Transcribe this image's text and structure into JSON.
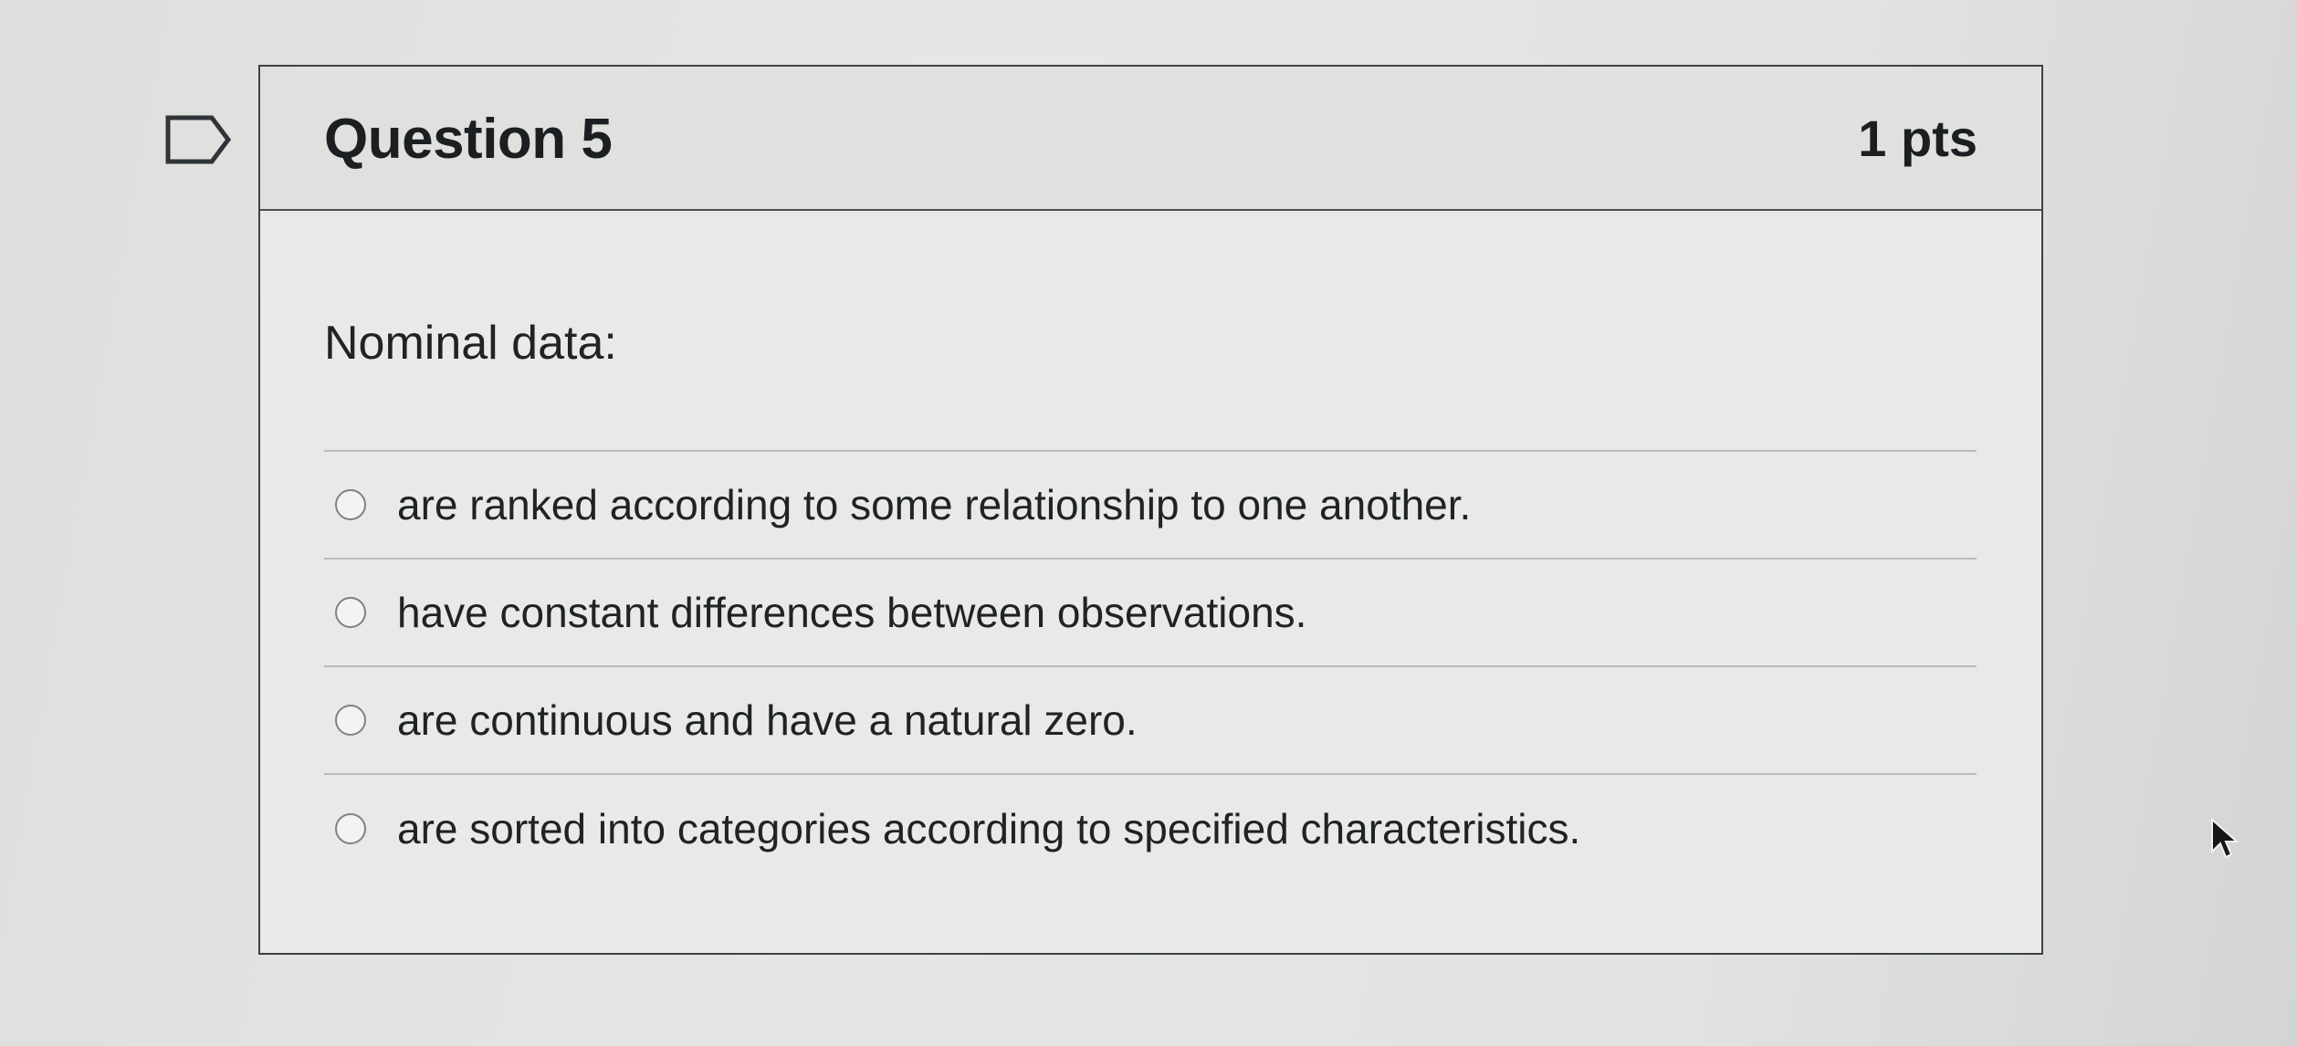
{
  "question": {
    "title": "Question 5",
    "points": "1 pts",
    "prompt": "Nominal data:",
    "flag_icon": "flag-question-icon",
    "answers": [
      {
        "label": "are ranked according to some relationship to one another.",
        "selected": false
      },
      {
        "label": "have constant differences between observations.",
        "selected": false
      },
      {
        "label": "are continuous and have a natural zero.",
        "selected": false
      },
      {
        "label": "are sorted into categories according to specified characteristics.",
        "selected": false
      }
    ]
  },
  "colors": {
    "border": "#3e4246",
    "header_bg": "#e0e1df",
    "text": "#1f2326"
  }
}
